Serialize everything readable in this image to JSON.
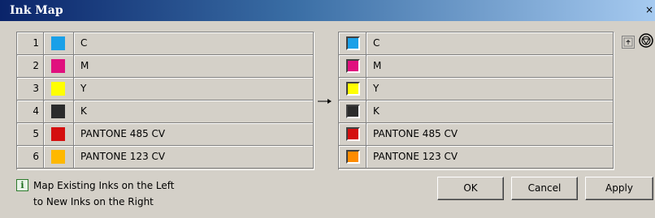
{
  "window": {
    "title": "Ink Map",
    "close_glyph": "×"
  },
  "left_inks": [
    {
      "num": "1",
      "name": "C",
      "color": "#1aa0e8"
    },
    {
      "num": "2",
      "name": "M",
      "color": "#e0107e"
    },
    {
      "num": "3",
      "name": "Y",
      "color": "#ffff00"
    },
    {
      "num": "4",
      "name": "K",
      "color": "#2b2b2b"
    },
    {
      "num": "5",
      "name": "PANTONE 485 CV",
      "color": "#d40f0f"
    },
    {
      "num": "6",
      "name": "PANTONE 123 CV",
      "color": "#ffb800"
    }
  ],
  "right_inks": [
    {
      "name": "C",
      "color": "#1aa0e8"
    },
    {
      "name": "M",
      "color": "#e0107e"
    },
    {
      "name": "Y",
      "color": "#ffff00"
    },
    {
      "name": "K",
      "color": "#2b2b2b"
    },
    {
      "name": "PANTONE 485 CV",
      "color": "#d40f0f"
    },
    {
      "name": "PANTONE 123 CV",
      "color": "#ff8c00"
    }
  ],
  "info": {
    "line1": "Map Existing Inks on the Left",
    "line2": "to New Inks on the Right",
    "icon": "info-icon"
  },
  "buttons": {
    "ok": "OK",
    "cancel": "Cancel",
    "apply": "Apply"
  },
  "icons": {
    "side_a": "move-up-icon",
    "side_b": "ink-gamut-icon",
    "arrow": "arrow-right-icon"
  }
}
